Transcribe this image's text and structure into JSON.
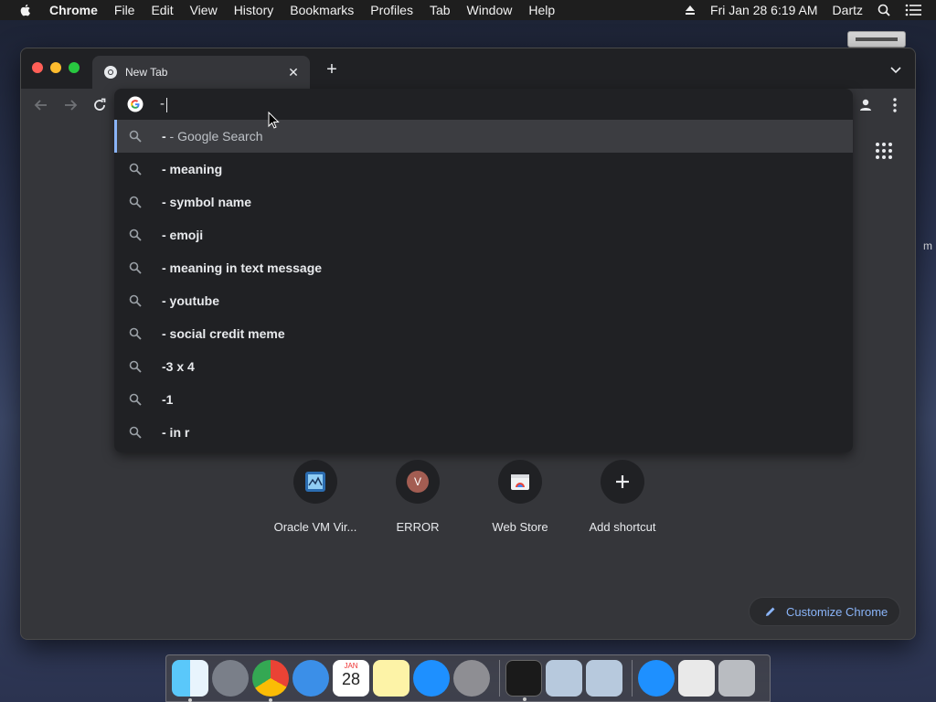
{
  "menubar": {
    "app_name": "Chrome",
    "menus": [
      "File",
      "Edit",
      "View",
      "History",
      "Bookmarks",
      "Profiles",
      "Tab",
      "Window",
      "Help"
    ],
    "datetime": "Fri Jan 28  6:19 AM",
    "user": "Dartz"
  },
  "desktop": {
    "peek_text": "m"
  },
  "tab": {
    "title": "New Tab"
  },
  "omnibox": {
    "value": "-",
    "suggestions": [
      {
        "bold": "-",
        "rest": " - Google Search"
      },
      {
        "bold": "- meaning",
        "rest": ""
      },
      {
        "bold": "- symbol name",
        "rest": ""
      },
      {
        "bold": "- emoji",
        "rest": ""
      },
      {
        "bold": "- meaning in text message",
        "rest": ""
      },
      {
        "bold": "- youtube",
        "rest": ""
      },
      {
        "bold": "- social credit meme",
        "rest": ""
      },
      {
        "bold": "-3 x 4",
        "rest": ""
      },
      {
        "bold": "-1",
        "rest": ""
      },
      {
        "bold": "- in r",
        "rest": ""
      }
    ]
  },
  "shortcuts": [
    {
      "label": "Oracle VM Vir...",
      "icon": "virtualbox-icon"
    },
    {
      "label": "ERROR",
      "icon": "letter-avatar-icon",
      "letter": "V"
    },
    {
      "label": "Web Store",
      "icon": "webstore-icon"
    },
    {
      "label": "Add shortcut",
      "icon": "plus-icon"
    }
  ],
  "customize": {
    "label": "Customize Chrome"
  },
  "dock": {
    "calendar_month": "JAN",
    "calendar_day": "28"
  },
  "colors": {
    "accent": "#8ab4f8",
    "window_bg": "#35363a",
    "omnibox_bg": "#202124"
  }
}
